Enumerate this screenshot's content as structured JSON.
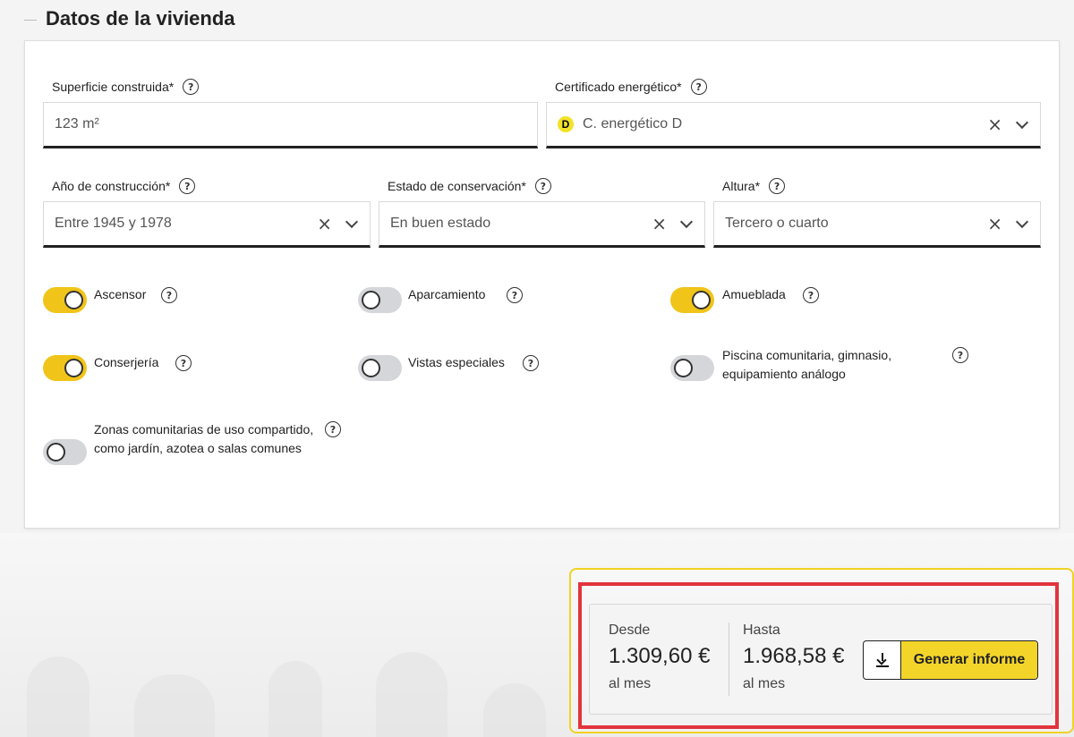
{
  "section": {
    "title": "Datos de la vivienda"
  },
  "fields": {
    "superficie": {
      "label": "Superficie construida*",
      "value": "123 m²"
    },
    "certificado": {
      "label": "Certificado energético*",
      "badge": "D",
      "value": "C. energético D"
    },
    "anio": {
      "label": "Año de construcción*",
      "value": "Entre 1945 y 1978"
    },
    "estado": {
      "label": "Estado de conservación*",
      "value": "En buen estado"
    },
    "altura": {
      "label": "Altura*",
      "value": "Tercero o cuarto"
    }
  },
  "toggles": [
    {
      "label": "Ascensor",
      "on": true
    },
    {
      "label": "Aparcamiento",
      "on": false
    },
    {
      "label": "Amueblada",
      "on": true
    },
    {
      "label": "Conserjería",
      "on": true
    },
    {
      "label": "Vistas especiales",
      "on": false
    },
    {
      "label": "Piscina comunitaria, gimnasio, equipamiento análogo",
      "on": false
    },
    {
      "label": "Zonas comunitarias de uso compartido, como jardín, azotea o salas comunes",
      "on": false
    }
  ],
  "result": {
    "desde_label": "Desde",
    "desde_value": "1.309,60 €",
    "hasta_label": "Hasta",
    "hasta_value": "1.968,58 €",
    "period": "al mes",
    "button_label": "Generar informe"
  },
  "icons": {
    "help": "?",
    "clear": "×"
  },
  "colors": {
    "accent": "#f0c419",
    "highlight": "#e2343c",
    "badge": "#f3e12a"
  }
}
